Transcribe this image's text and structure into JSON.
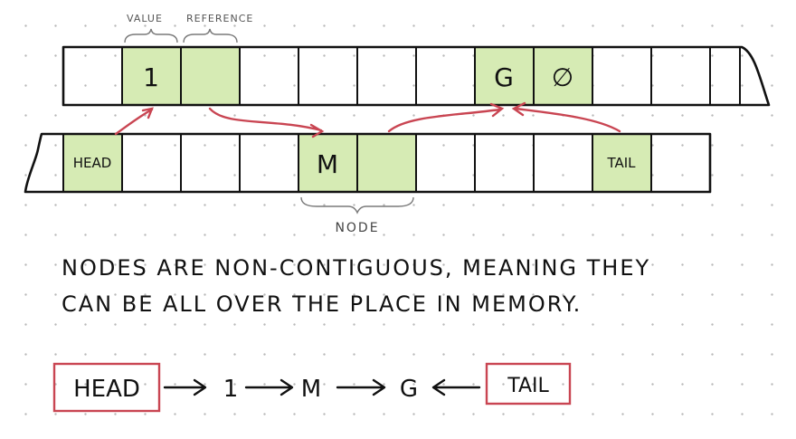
{
  "labels": {
    "value": "VALUE",
    "reference": "REFERENCE",
    "node": "NODE"
  },
  "top_row": {
    "value_cell": "1",
    "g_cell": "G",
    "null_symbol": "∅"
  },
  "bottom_row": {
    "head_cell": "HEAD",
    "m_cell": "M",
    "tail_cell": "TAIL"
  },
  "caption": {
    "line1": "NODES ARE NON-CONTIGUOUS, MEANING THEY",
    "line2": "CAN BE ALL OVER THE PLACE IN MEMORY."
  },
  "flow": {
    "head": "HEAD",
    "step1": "1",
    "step2": "M",
    "step3": "G",
    "tail": "TAIL"
  },
  "colors": {
    "node_fill": "#d6ebb4",
    "arrow": "#c94552",
    "ink": "#111111"
  }
}
